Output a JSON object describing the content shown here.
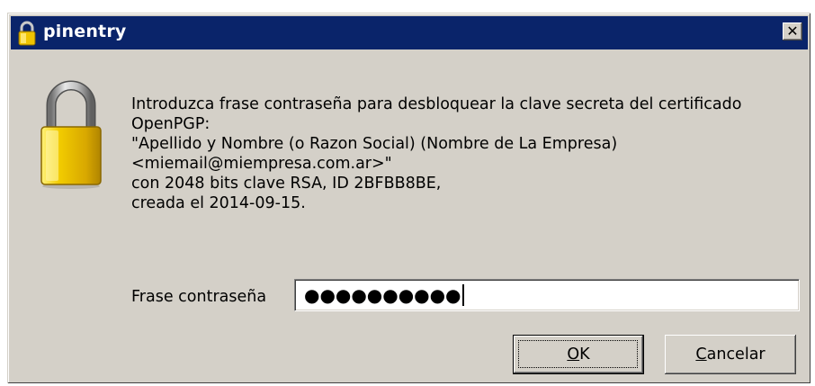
{
  "window": {
    "title": "pinentry",
    "close_glyph": "✕"
  },
  "icons": {
    "title_icon": "padlock-icon",
    "main_icon": "padlock-icon",
    "lock_body_color": "#e8c000",
    "lock_shackle_color": "#a0a0a0",
    "titlebar_color": "#0a246a",
    "dialog_bg": "#d4d0c8"
  },
  "message": {
    "lines": [
      "Introduzca frase contraseña para desbloquear la clave secreta del certificado",
      "OpenPGP:",
      "\"Apellido y Nombre (o Razon Social) (Nombre de La Empresa)",
      "<miemail@miempresa.com.ar>\"",
      "con 2048 bits clave RSA, ID 2BFBB8BE,",
      "creada el 2014-09-15."
    ]
  },
  "passphrase": {
    "label": "Frase contraseña",
    "masked_value": "●●●●●●●●●●"
  },
  "buttons": {
    "ok_accel": "O",
    "ok_rest": "K",
    "cancel_accel": "C",
    "cancel_rest": "ancelar"
  }
}
